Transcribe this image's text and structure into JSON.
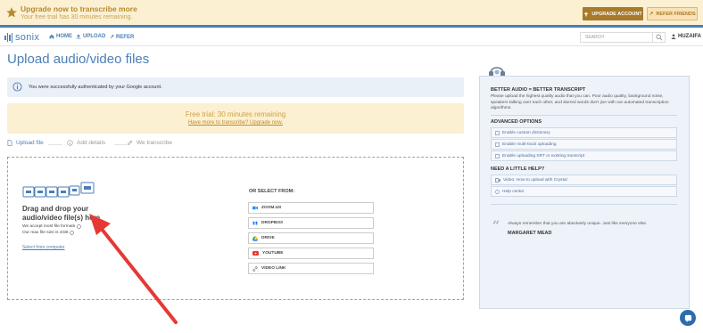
{
  "banner": {
    "title": "Upgrade now to transcribe more",
    "subtitle": "Your free trial has 30 minutes remaining.",
    "upgrade_label": "UPGRADE ACCOUNT",
    "refer_label": "REFER FRIENDS"
  },
  "nav": {
    "logo": "sonix",
    "items": [
      "HOME",
      "UPLOAD",
      "REFER"
    ],
    "search_placeholder": "SEARCH",
    "user": "HUZAIFA"
  },
  "page_title": "Upload audio/video files",
  "auth_message": "You were successfully authenticated by your Google account.",
  "trial": {
    "title": "Free trial: 30 minutes remaining",
    "link": "Have more to transcribe? Upgrade now."
  },
  "steps": [
    "Upload file",
    "Add details",
    "We transcribe"
  ],
  "drop": {
    "heading": "Drag and drop your audio/video file(s) here",
    "formats": "We accept most file formats",
    "max_size": "Our max file size is 4GB",
    "select_link": "Select from computer",
    "or_select": "OR SELECT FROM:",
    "sources": [
      "ZOOM.US",
      "DROPBOX",
      "DRIVE",
      "YOUTUBE",
      "VIDEO LINK"
    ]
  },
  "sidebar": {
    "better_title": "BETTER AUDIO = BETTER TRANSCRIPT",
    "better_text": "Please upload the highest quality audio that you can. Poor audio quality, background noise, speakers talking over each other, and slurred words don't jive with our automated transcription algorithms.",
    "advanced_title": "ADVANCED OPTIONS",
    "advanced_options": [
      "Enable custom dictionary",
      "Enable multi-track uploading",
      "Enable uploading SRT or existing transcript"
    ],
    "help_title": "NEED A LITTLE HELP?",
    "help_options": [
      "Video: How to upload with Crystal",
      "Help center"
    ],
    "quote": "Always remember that you are absolutely unique. Just like everyone else.",
    "quote_author": "MARGARET MEAD"
  },
  "colors": {
    "accent": "#4a7fb5",
    "banner_bg": "#fbf0d2",
    "upgrade_btn": "#a87a2b",
    "arrow": "#e53935"
  }
}
